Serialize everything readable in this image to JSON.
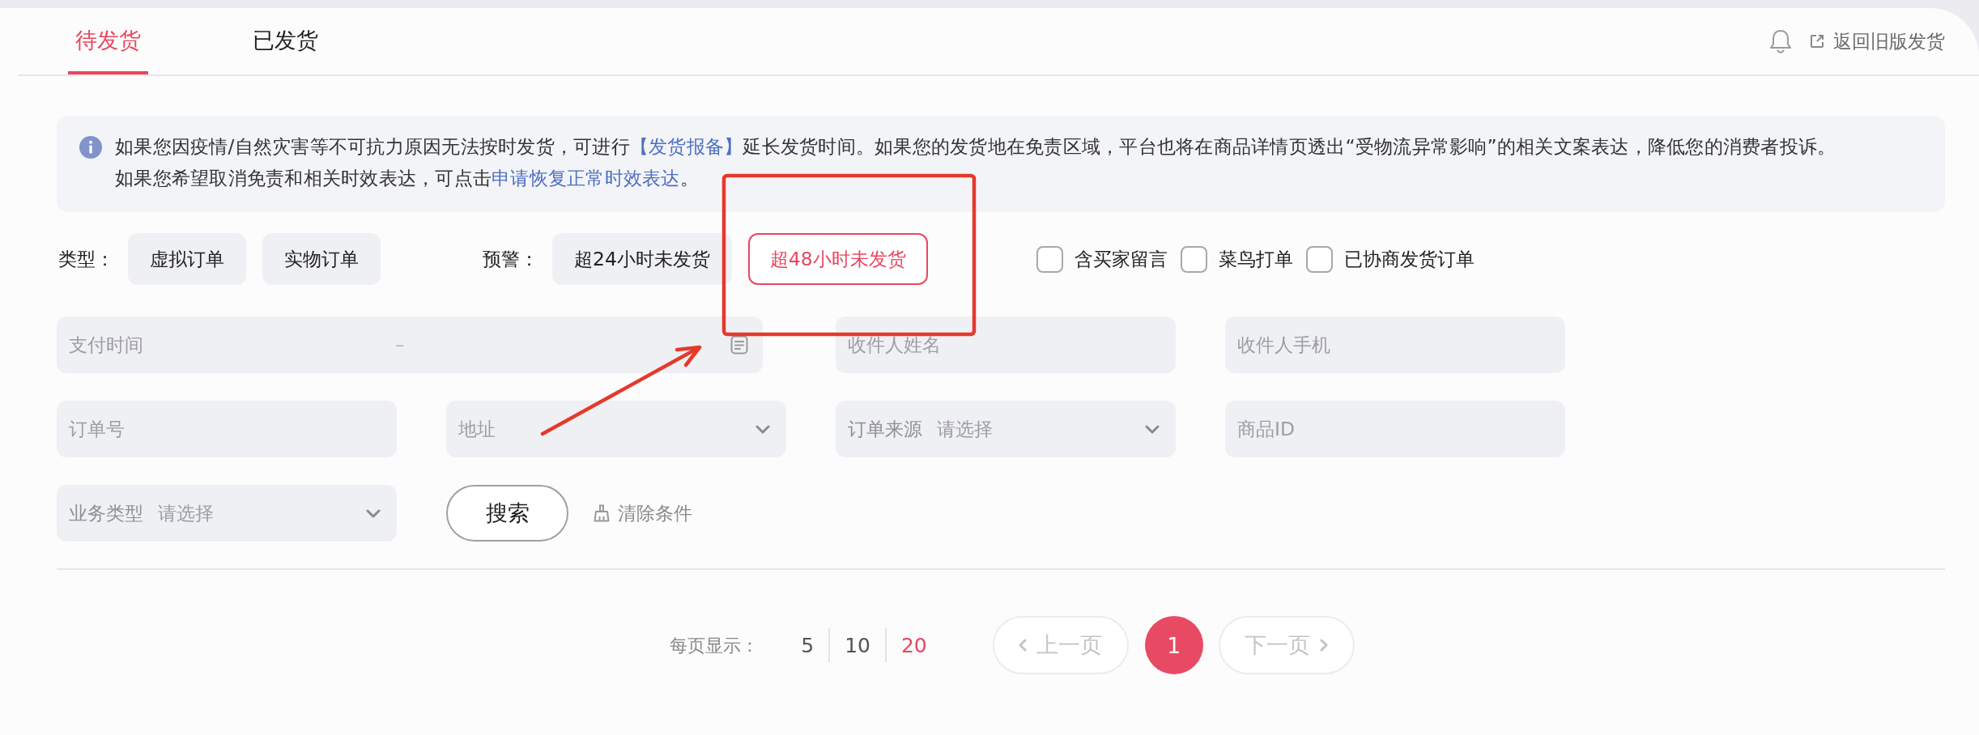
{
  "tabs": [
    {
      "label": "待发货",
      "selected": true
    },
    {
      "label": "已发货",
      "selected": false
    }
  ],
  "header": {
    "back_link": "返回旧版发货"
  },
  "notice": {
    "lines": [
      [
        {
          "kind": "text",
          "text": "如果您因疫情/自然灾害等不可抗力原因无法按时发货，可进行"
        },
        {
          "kind": "link",
          "text": "【发货报备】"
        },
        {
          "kind": "text",
          "text": "延长发货时间。如果您的发货地在免责区域，平台也将在商品详情页透出“受物流异常影响”的相关文案表达，降低您的消费者投诉。"
        }
      ],
      [
        {
          "kind": "text",
          "text": "如果您希望取消免责和相关时效表达，可点击"
        },
        {
          "kind": "link",
          "text": "申请恢复正常时效表达"
        },
        {
          "kind": "text",
          "text": "。"
        }
      ]
    ]
  },
  "filters": {
    "type": {
      "label": "类型：",
      "options": [
        {
          "label": "虚拟订单",
          "selected": false
        },
        {
          "label": "实物订单",
          "selected": false
        }
      ]
    },
    "warning": {
      "label": "预警：",
      "options": [
        {
          "label": "超24小时未发货",
          "selected": false
        },
        {
          "label": "超48小时未发货",
          "selected": true
        }
      ]
    },
    "checkboxes": [
      {
        "label": "含买家留言",
        "checked": false
      },
      {
        "label": "菜鸟打单",
        "checked": false
      },
      {
        "label": "已协商发货订单",
        "checked": false
      }
    ]
  },
  "search_form": {
    "fields": [
      {
        "kind": "date_range",
        "placeholder": "支付时间",
        "separator": "–"
      },
      {
        "kind": "text",
        "placeholder": "收件人姓名"
      },
      {
        "kind": "text",
        "placeholder": "收件人手机"
      },
      {
        "kind": "text",
        "placeholder": "订单号"
      },
      {
        "kind": "select",
        "placeholder": "地址"
      },
      {
        "kind": "select",
        "label": "订单来源",
        "placeholder": "请选择"
      },
      {
        "kind": "text",
        "placeholder": "商品ID"
      },
      {
        "kind": "select",
        "label": "业务类型",
        "placeholder": "请选择"
      }
    ],
    "search_button": "搜索",
    "clear_button": "清除条件"
  },
  "pagination": {
    "page_size_label": "每页显示：",
    "page_sizes": [
      {
        "label": "5",
        "selected": false
      },
      {
        "label": "10",
        "selected": false
      },
      {
        "label": "20",
        "selected": true
      }
    ],
    "prev": {
      "label": "上一页",
      "disabled": true
    },
    "pages": [
      {
        "label": "1",
        "selected": true
      }
    ],
    "next": {
      "label": "下一页",
      "disabled": true
    }
  }
}
